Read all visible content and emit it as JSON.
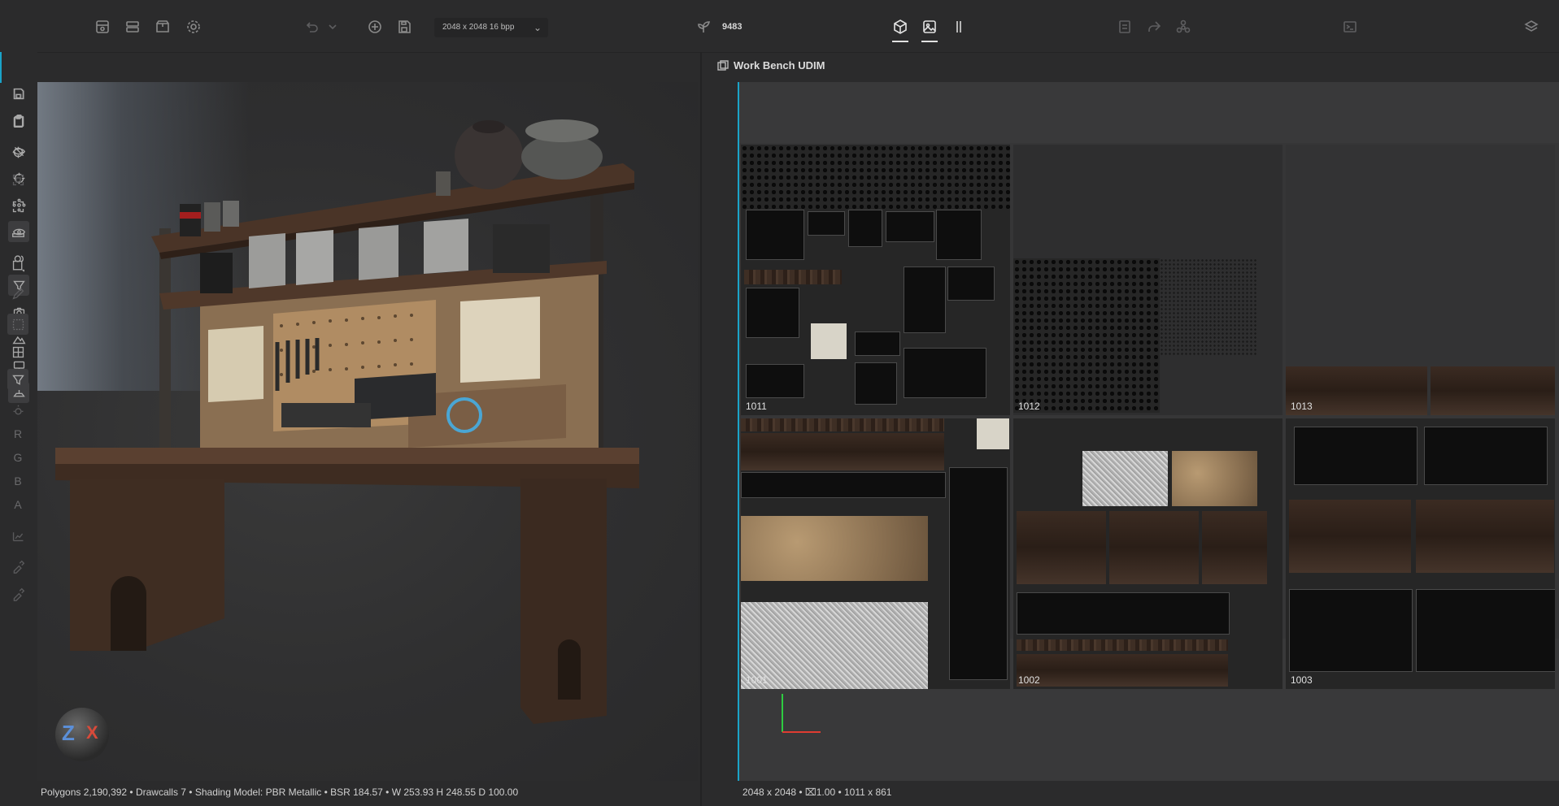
{
  "toolbar": {
    "resolution_select": "2048 x 2048 16 bpp",
    "seed_value": "9483"
  },
  "uv_panel": {
    "title": "Work Bench UDIM",
    "channels": [
      "R",
      "G",
      "B",
      "A"
    ],
    "tiles": [
      "1011",
      "1012",
      "1013",
      "1001",
      "1002",
      "1003"
    ],
    "status": "2048 x 2048 • ⌧1.00 • 1011 x 861"
  },
  "viewport": {
    "status": "Polygons 2,190,392 • Drawcalls 7 • Shading Model: PBR Metallic • BSR 184.57 • W 253.93 H 248.55 D 100.00"
  },
  "icons": [
    "grid-icon",
    "layout-icon",
    "package-icon",
    "gear-icon",
    "undo-icon",
    "chevron-down-icon",
    "add-circle-icon",
    "save-icon",
    "seed-icon",
    "cube-icon",
    "image-icon",
    "split-icon",
    "print-icon",
    "share-icon",
    "network-icon",
    "terminal-icon",
    "layers-icon"
  ]
}
